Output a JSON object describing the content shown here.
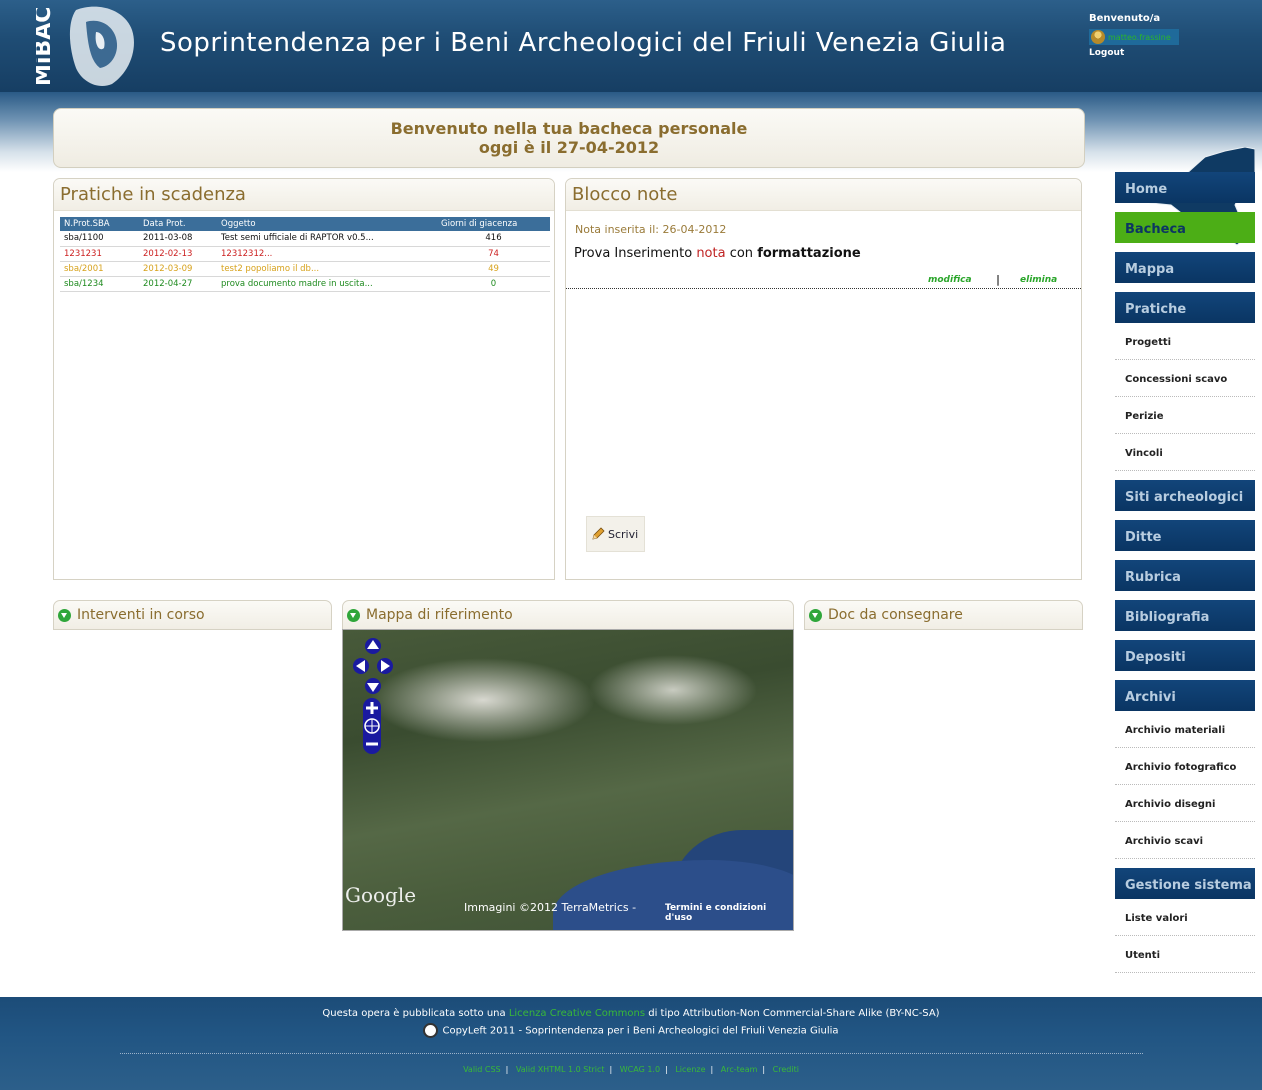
{
  "header": {
    "logo_text": "MiBAC",
    "title": "Soprintendenza per i Beni Archeologici del Friuli Venezia Giulia",
    "welcome": "Benvenuto/a",
    "user": "matteo.frassine",
    "logout": "Logout"
  },
  "welcome_box": {
    "line1": "Benvenuto nella tua bacheca personale",
    "line2": "oggi è il 27-04-2012"
  },
  "pratiche": {
    "title": "Pratiche in scadenza",
    "columns": [
      "N.Prot.SBA",
      "Data Prot.",
      "Oggetto",
      "Giorni di giacenza"
    ],
    "rows": [
      {
        "prot": "sba/1100",
        "data": "2011-03-08",
        "oggetto": "Test semi ufficiale di RAPTOR v0.5...",
        "giorni": "416",
        "color": "#111111"
      },
      {
        "prot": "1231231",
        "data": "2012-02-13",
        "oggetto": "12312312...",
        "giorni": "74",
        "color": "#cc1f1f"
      },
      {
        "prot": "sba/2001",
        "data": "2012-03-09",
        "oggetto": "test2 popoliamo il db...",
        "giorni": "49",
        "color": "#d7a21c"
      },
      {
        "prot": "sba/1234",
        "data": "2012-04-27",
        "oggetto": "prova documento madre in uscita...",
        "giorni": "0",
        "color": "#1e8a1e"
      }
    ]
  },
  "blocco": {
    "title": "Blocco note",
    "date": "Nota inserita il: 26-04-2012",
    "text_pre": "Prova Inserimento ",
    "text_red": "nota",
    "text_mid": " con ",
    "text_bold": "formattazione",
    "modifica": "modifica",
    "separator": "|",
    "elimina": "elimina",
    "scrivi": "Scrivi"
  },
  "boxes": {
    "interventi": "Interventi in corso",
    "mappa": "Mappa di riferimento",
    "doc": "Doc da consegnare"
  },
  "map": {
    "provider": "Google",
    "copyright": "Immagini ©2012 TerraMetrics -",
    "terms": "Termini e condizioni d'uso"
  },
  "menu": {
    "home": "Home",
    "bacheca": "Bacheca",
    "mappa": "Mappa",
    "pratiche": "Pratiche",
    "pratiche_items": [
      "Progetti",
      "Concessioni scavo",
      "Perizie",
      "Vincoli"
    ],
    "siti": "Siti archeologici",
    "ditte": "Ditte",
    "rubrica": "Rubrica",
    "bibliografia": "Bibliografia",
    "depositi": "Depositi",
    "archivi": "Archivi",
    "archivi_items": [
      "Archivio materiali",
      "Archivio fotografico",
      "Archivio disegni",
      "Archivio scavi"
    ],
    "gestione": "Gestione sistema",
    "gestione_items": [
      "Liste valori",
      "Utenti"
    ]
  },
  "footer": {
    "l1_pre": "Questa opera è pubblicata sotto una ",
    "l1_link": "Licenza Creative Commons",
    "l1_post": " di tipo Attribution-Non Commercial-Share Alike (BY-NC-SA)",
    "l2": "CopyLeft 2011 - Soprintendenza per i Beni Archeologici del Friuli Venezia Giulia",
    "links": [
      "Valid CSS",
      "Valid XHTML 1.0 Strict",
      "WCAG 1.0",
      "Licenze",
      "Arc-team",
      "Crediti"
    ]
  },
  "colors": {
    "header_blue": "#1f4d75",
    "menu_blue": "#0a3563",
    "menu_active": "#4cae16",
    "panel_title": "#8a6d2f",
    "link_green": "#39b839"
  }
}
